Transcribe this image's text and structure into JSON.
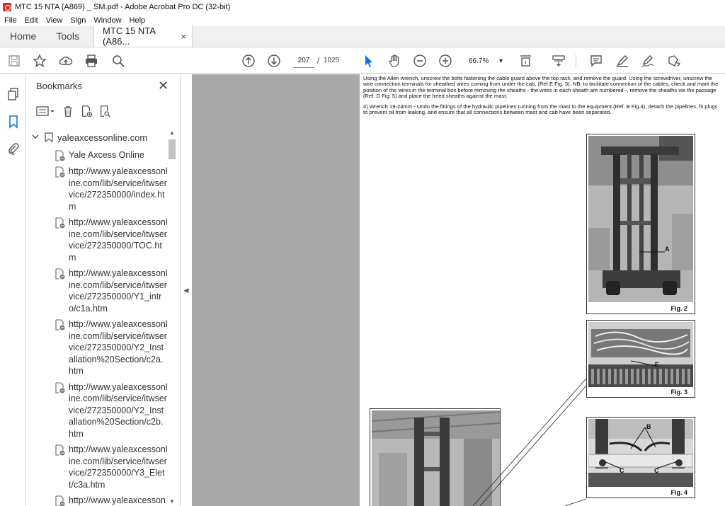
{
  "window": {
    "title": "MTC 15 NTA  (A869) _ SM.pdf - Adobe Acrobat Pro DC (32-bit)"
  },
  "menu": [
    "File",
    "Edit",
    "View",
    "Sign",
    "Window",
    "Help"
  ],
  "tabs": {
    "home": "Home",
    "tools": "Tools",
    "document": "MTC 15 NTA  (A86...",
    "close": "×"
  },
  "toolbar": {
    "current_page": "207",
    "page_separator": "/",
    "total_pages": "1025",
    "zoom": "66.7%",
    "zoom_caret": "▾"
  },
  "bookmarks": {
    "header": "Bookmarks",
    "close": "✕",
    "root": "yaleaxcessonline.com",
    "items": [
      "Yale Axcess Online",
      "http://www.yaleaxcessonline.com/lib/service/itwservice/272350000/index.htm",
      "http://www.yaleaxcessonline.com/lib/service/itwservice/272350000/TOC.htm",
      "http://www.yaleaxcessonline.com/lib/service/itwservice/272350000/Y1_intro/c1a.htm",
      "http://www.yaleaxcessonline.com/lib/service/itwservice/272350000/Y2_Installation%20Section/c2a.htm",
      "http://www.yaleaxcessonline.com/lib/service/itwservice/272350000/Y2_Installation%20Section/c2b.htm",
      "http://www.yaleaxcessonline.com/lib/service/itwservice/272350000/Y3_Elett/c3a.htm",
      "http://www.yaleaxcesson"
    ]
  },
  "document": {
    "paragraph1": "Using the Allen wrench, unscrew the bolts fastening the cable guard above the top rack, and remove the guard. Using the screwdriver, unscrew the wire connection terminals for sheathed wires coming from under the cab, (Ref.E Fig. 3). NB: to facilitate connection of the cables, check and mark the position of the wires in the terminal box before removing the sheaths - the wires in each sheath are numbered -, remove the sheaths via the passage (Ref. D Fig. 5) and place the freed sheaths against the mast.",
    "paragraph2": "4) Wrench 19-24mm - Undo the fittings of the hydraulic pipelines running from the mast to the equipment (Ref. B Fig.4), detach the pipelines, fit plugs to prevent oil from leaking, and ensure that all connections between mast and cab have been separated.",
    "figures": {
      "fig2": {
        "caption": "Fig. 2",
        "callout_a": "A"
      },
      "fig3": {
        "caption": "Fig. 3",
        "callout_e": "E"
      },
      "fig4": {
        "caption": "Fig. 4",
        "callout_b": "B",
        "callout_c1": "C",
        "callout_c2": "C"
      }
    }
  },
  "colors": {
    "accent": "#1473e6",
    "app_icon": "#d32f2f",
    "canvas_grey": "#a8a8a8"
  }
}
